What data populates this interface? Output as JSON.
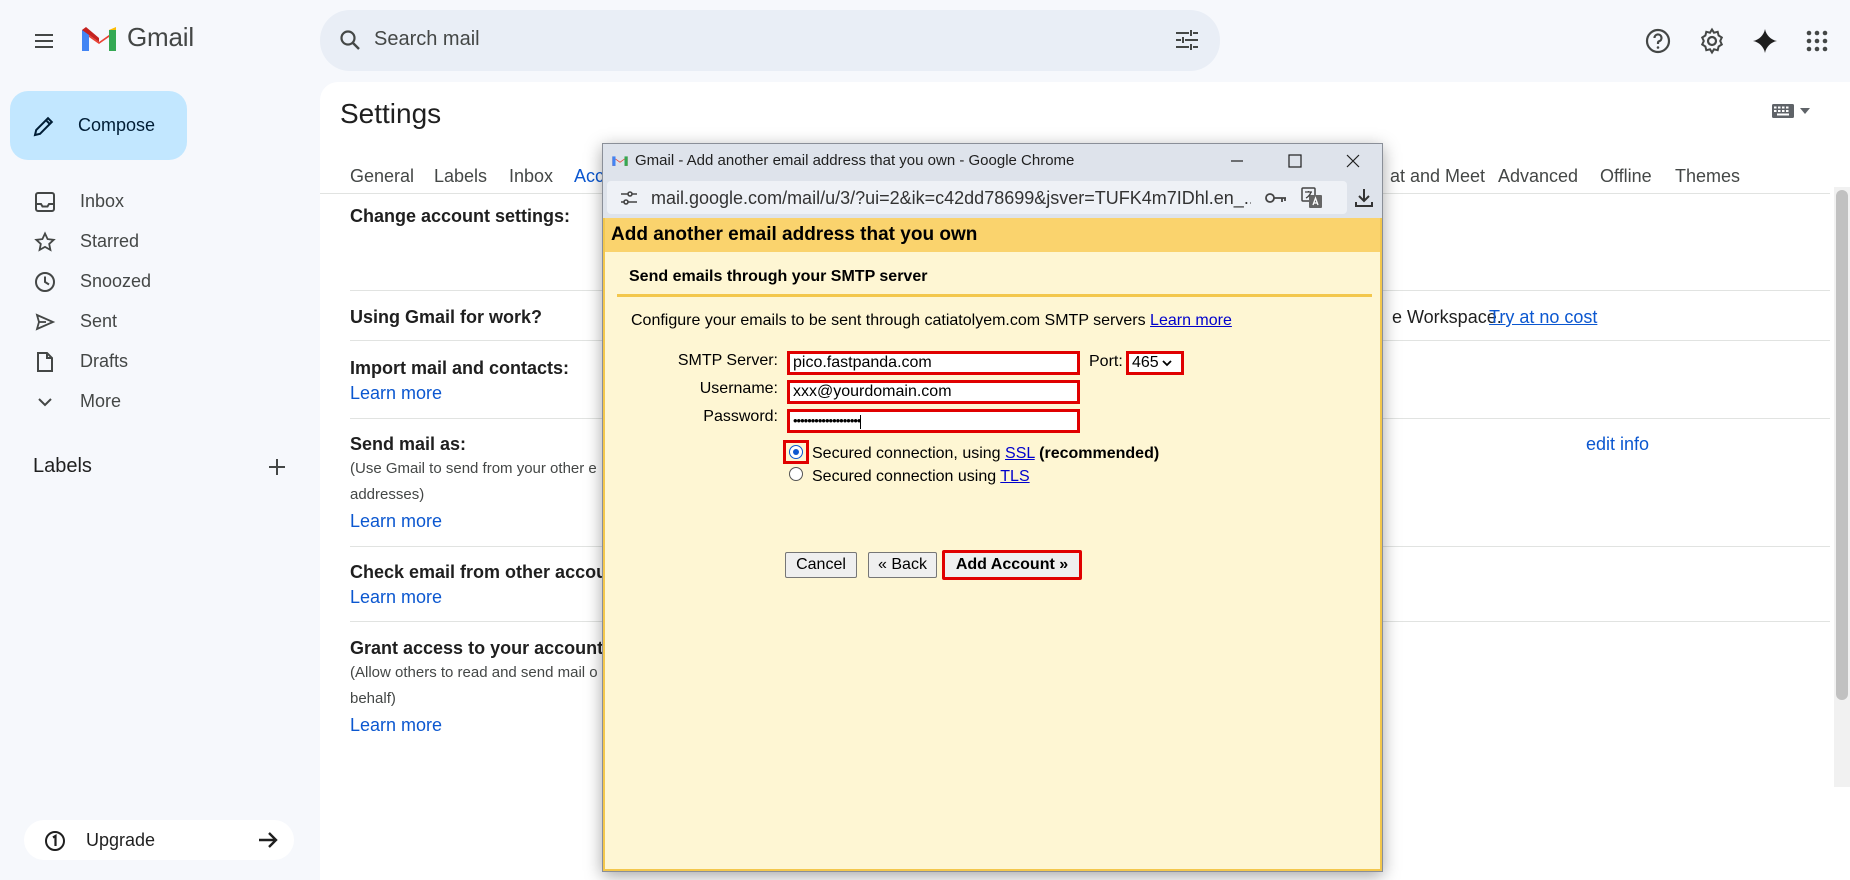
{
  "app": {
    "name": "Gmail"
  },
  "search": {
    "placeholder": "Search mail"
  },
  "nav": {
    "compose": "Compose",
    "items": [
      {
        "label": "Inbox",
        "icon": "inbox-icon"
      },
      {
        "label": "Starred",
        "icon": "star-icon"
      },
      {
        "label": "Snoozed",
        "icon": "clock-icon"
      },
      {
        "label": "Sent",
        "icon": "send-icon"
      },
      {
        "label": "Drafts",
        "icon": "draft-icon"
      },
      {
        "label": "More",
        "icon": "chevron-down-icon"
      }
    ],
    "labels_title": "Labels",
    "upgrade": "Upgrade"
  },
  "settings": {
    "title": "Settings",
    "tabs": [
      "General",
      "Labels",
      "Inbox",
      "Acc",
      "at and Meet",
      "Advanced",
      "Offline",
      "Themes"
    ],
    "rows": {
      "change_account": "Change account settings:",
      "gmail_work": "Using Gmail for work?",
      "gmail_work_right": "e Workspace.",
      "try_link": "Try at no cost",
      "import": "Import mail and contacts:",
      "learn_more": "Learn more",
      "send_as": "Send mail as:",
      "send_as_sub1": "(Use Gmail to send from your other e",
      "send_as_sub2": "addresses)",
      "edit_info": "edit info",
      "check_email": "Check email from other accou",
      "grant": "Grant access to your account",
      "grant_sub1": "(Allow others to read and send mail o",
      "grant_sub2": "behalf)"
    }
  },
  "popup": {
    "window_title": "Gmail - Add another email address that you own - Google Chrome",
    "url": "mail.google.com/mail/u/3/?ui=2&ik=c42dd78699&jsver=TUFK4m7IDhl.en_...",
    "header": "Add another email address that you own",
    "subheader": "Send emails through your SMTP server",
    "description": "Configure your emails to be sent through catiatolyem.com SMTP servers",
    "learn_more": "Learn more",
    "smtp_label": "SMTP Server:",
    "smtp_value": "pico.fastpanda.com",
    "port_label": "Port:",
    "port_value": "465",
    "username_label": "Username:",
    "username_value": "xxx@yourdomain.com",
    "password_label": "Password:",
    "password_value": "•••••••••••••••••••",
    "ssl_text": "Secured connection, using",
    "ssl_link": "SSL",
    "ssl_recommended": "(recommended)",
    "tls_text": "Secured connection using",
    "tls_link": "TLS",
    "cancel": "Cancel",
    "back": "« Back",
    "add_account": "Add Account »"
  },
  "colors": {
    "accent": "#0b57d0",
    "compose_bg": "#c2e7ff",
    "dialog_header": "#fad36d",
    "dialog_bg": "#fef6d3",
    "highlight": "#e00000"
  }
}
